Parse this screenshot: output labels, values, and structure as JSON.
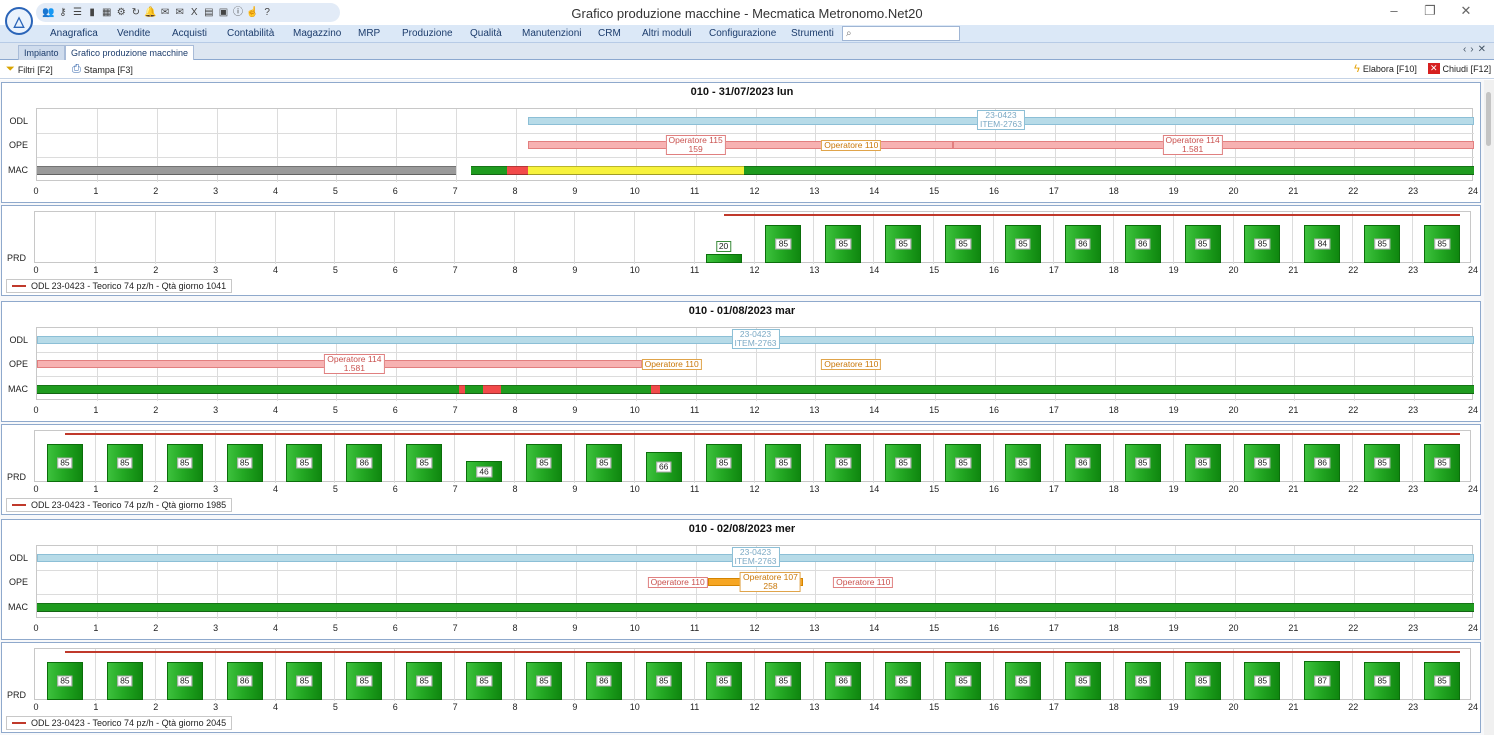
{
  "app": {
    "title": "Grafico produzione macchine - Mecmatica Metronomo.Net20",
    "logo_icon": "metronomo-logo-icon",
    "window_buttons": [
      "–",
      "❐",
      "✕"
    ],
    "quick_access_icons": [
      "users-icon",
      "user-key-icon",
      "list-icon",
      "flag-it-icon",
      "calendar-icon",
      "gear-icon",
      "refresh-icon",
      "bell-icon",
      "mail-icon",
      "mail-send-icon",
      "excel-icon",
      "calculator-icon",
      "monitor-icon",
      "info-icon",
      "hand-icon",
      "help-icon"
    ]
  },
  "menu": {
    "items": [
      "Anagrafica",
      "Vendite",
      "Acquisti",
      "Contabilità",
      "Magazzino",
      "MRP",
      "Produzione",
      "Qualità",
      "Manutenzioni",
      "CRM",
      "Altri moduli",
      "Configurazione",
      "Strumenti"
    ],
    "search_icon": "search-icon"
  },
  "tabs": [
    {
      "label": "Impianto",
      "active": false
    },
    {
      "label": "Grafico produzione macchine",
      "active": true
    }
  ],
  "toolbar": {
    "filters": "Filtri [F2]",
    "print": "Stampa [F3]",
    "process": "Elabora [F10]",
    "close": "Chiudi [F12]"
  },
  "colors": {
    "odl": "#b7dbe8",
    "ope_red": "#f7b2b2",
    "ope_orange": "#f6a623",
    "mac_green": "#1f9b1f",
    "mac_red": "#f24a4a",
    "mac_yellow": "#f7f23c",
    "mac_gray": "#9a9a9a",
    "theoretical": "#c0392b"
  },
  "row_labels": {
    "odl": "ODL",
    "ope": "OPE",
    "mac": "MAC",
    "prd": "PRD"
  },
  "days": [
    {
      "title": "010 - 31/07/2023 lun",
      "odl": [
        {
          "start": 8.2,
          "end": 24,
          "label": "23-0423\nITEM-2763",
          "label_at": 16.1
        }
      ],
      "ope": [
        {
          "start": 8.2,
          "end": 15.3,
          "color": "red"
        },
        {
          "start": 15.3,
          "end": 24,
          "color": "red"
        }
      ],
      "ope_labels": [
        {
          "text": "Operatore 115\n159",
          "at": 11,
          "color": "red"
        },
        {
          "text": "Operatore 110",
          "at": 13.6,
          "color": "orange"
        },
        {
          "text": "Operatore 114\n1.581",
          "at": 19.3,
          "color": "red"
        }
      ],
      "mac": [
        {
          "start": 0,
          "end": 7.0,
          "color": "gray"
        },
        {
          "start": 7.25,
          "end": 7.85,
          "color": "green"
        },
        {
          "start": 7.85,
          "end": 8.2,
          "color": "red"
        },
        {
          "start": 8.2,
          "end": 11.8,
          "color": "yellow"
        },
        {
          "start": 11.8,
          "end": 24,
          "color": "green"
        }
      ],
      "prd": [
        {
          "hour": 11,
          "value": 20
        },
        {
          "hour": 12,
          "value": 85
        },
        {
          "hour": 13,
          "value": 85
        },
        {
          "hour": 14,
          "value": 85
        },
        {
          "hour": 15,
          "value": 85
        },
        {
          "hour": 16,
          "value": 85
        },
        {
          "hour": 17,
          "value": 86
        },
        {
          "hour": 18,
          "value": 86
        },
        {
          "hour": 19,
          "value": 85
        },
        {
          "hour": 20,
          "value": 85
        },
        {
          "hour": 21,
          "value": 84
        },
        {
          "hour": 22,
          "value": 85
        },
        {
          "hour": 23,
          "value": 85
        }
      ],
      "theoretical": {
        "value": 74,
        "start": 11.5,
        "end": 23.8
      },
      "legend": "ODL 23-0423 - Teorico 74 pz/h - Qtà giorno 1041"
    },
    {
      "title": "010 - 01/08/2023 mar",
      "odl": [
        {
          "start": 0,
          "end": 24,
          "label": "23-0423\nITEM-2763",
          "label_at": 12
        }
      ],
      "ope": [
        {
          "start": 0,
          "end": 10.1,
          "color": "red"
        }
      ],
      "ope_labels": [
        {
          "text": "Operatore 114\n1.581",
          "at": 5.3,
          "color": "red"
        },
        {
          "text": "Operatore 110",
          "at": 10.6,
          "color": "orange"
        },
        {
          "text": "Operatore 110",
          "at": 13.6,
          "color": "orange"
        }
      ],
      "mac": [
        {
          "start": 0,
          "end": 24,
          "color": "green"
        },
        {
          "start": 7.05,
          "end": 7.15,
          "color": "red"
        },
        {
          "start": 7.45,
          "end": 7.75,
          "color": "red"
        },
        {
          "start": 10.25,
          "end": 10.4,
          "color": "red"
        }
      ],
      "prd": [
        {
          "hour": 0,
          "value": 85
        },
        {
          "hour": 1,
          "value": 85
        },
        {
          "hour": 2,
          "value": 85
        },
        {
          "hour": 3,
          "value": 85
        },
        {
          "hour": 4,
          "value": 85
        },
        {
          "hour": 5,
          "value": 86
        },
        {
          "hour": 6,
          "value": 85
        },
        {
          "hour": 7,
          "value": 46
        },
        {
          "hour": 8,
          "value": 85
        },
        {
          "hour": 9,
          "value": 85
        },
        {
          "hour": 10,
          "value": 66
        },
        {
          "hour": 11,
          "value": 85
        },
        {
          "hour": 12,
          "value": 85
        },
        {
          "hour": 13,
          "value": 85
        },
        {
          "hour": 14,
          "value": 85
        },
        {
          "hour": 15,
          "value": 85
        },
        {
          "hour": 16,
          "value": 85
        },
        {
          "hour": 17,
          "value": 86
        },
        {
          "hour": 18,
          "value": 85
        },
        {
          "hour": 19,
          "value": 85
        },
        {
          "hour": 20,
          "value": 85
        },
        {
          "hour": 21,
          "value": 86
        },
        {
          "hour": 22,
          "value": 85
        },
        {
          "hour": 23,
          "value": 85
        }
      ],
      "theoretical": {
        "value": 74,
        "start": 0.5,
        "end": 23.8
      },
      "legend": "ODL 23-0423 - Teorico 74 pz/h - Qtà giorno 1985"
    },
    {
      "title": "010 - 02/08/2023 mer",
      "odl": [
        {
          "start": 0,
          "end": 24,
          "label": "23-0423\nITEM-2763",
          "label_at": 12
        }
      ],
      "ope": [
        {
          "start": 11.2,
          "end": 12.8,
          "color": "orange"
        }
      ],
      "ope_labels": [
        {
          "text": "Operatore 110",
          "at": 10.7,
          "color": "red"
        },
        {
          "text": "Operatore 107\n258",
          "at": 12.25,
          "color": "orange"
        },
        {
          "text": "Operatore 110",
          "at": 13.8,
          "color": "red"
        }
      ],
      "mac": [
        {
          "start": 0,
          "end": 24,
          "color": "green"
        }
      ],
      "prd": [
        {
          "hour": 0,
          "value": 85
        },
        {
          "hour": 1,
          "value": 85
        },
        {
          "hour": 2,
          "value": 85
        },
        {
          "hour": 3,
          "value": 86
        },
        {
          "hour": 4,
          "value": 85
        },
        {
          "hour": 5,
          "value": 85
        },
        {
          "hour": 6,
          "value": 85
        },
        {
          "hour": 7,
          "value": 85
        },
        {
          "hour": 8,
          "value": 85
        },
        {
          "hour": 9,
          "value": 86
        },
        {
          "hour": 10,
          "value": 85
        },
        {
          "hour": 11,
          "value": 85
        },
        {
          "hour": 12,
          "value": 85
        },
        {
          "hour": 13,
          "value": 86
        },
        {
          "hour": 14,
          "value": 85
        },
        {
          "hour": 15,
          "value": 85
        },
        {
          "hour": 16,
          "value": 85
        },
        {
          "hour": 17,
          "value": 85
        },
        {
          "hour": 18,
          "value": 85
        },
        {
          "hour": 19,
          "value": 85
        },
        {
          "hour": 20,
          "value": 85
        },
        {
          "hour": 21,
          "value": 87
        },
        {
          "hour": 22,
          "value": 85
        },
        {
          "hour": 23,
          "value": 85
        }
      ],
      "theoretical": {
        "value": 74,
        "start": 0.5,
        "end": 23.8
      },
      "legend": "ODL 23-0423 - Teorico 74 pz/h - Qtà giorno 2045"
    }
  ],
  "chart_data": {
    "type": "bar",
    "x_range": [
      0,
      24
    ],
    "ticks": [
      0,
      1,
      2,
      3,
      4,
      5,
      6,
      7,
      8,
      9,
      10,
      11,
      12,
      13,
      14,
      15,
      16,
      17,
      18,
      19,
      20,
      21,
      22,
      23,
      24
    ],
    "y_max": 85
  }
}
